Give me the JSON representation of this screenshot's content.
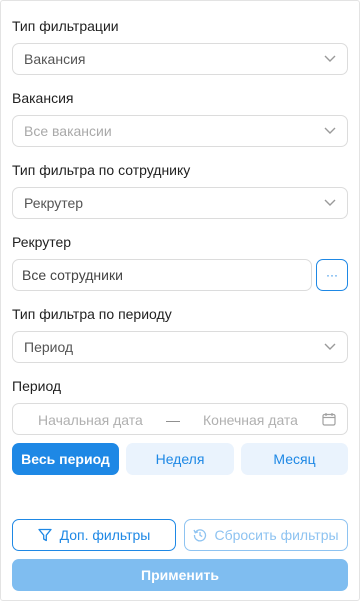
{
  "filter_type": {
    "label": "Тип фильтрации",
    "value": "Вакансия"
  },
  "vacancy": {
    "label": "Вакансия",
    "placeholder": "Все вакансии"
  },
  "employee_filter_type": {
    "label": "Тип фильтра по сотруднику",
    "value": "Рекрутер"
  },
  "recruiter": {
    "label": "Рекрутер",
    "value": "Все сотрудники",
    "more_label": "···"
  },
  "period_filter_type": {
    "label": "Тип фильтра по периоду",
    "value": "Период"
  },
  "period": {
    "label": "Период",
    "start_placeholder": "Начальная дата",
    "separator": "—",
    "end_placeholder": "Конечная дата",
    "presets": [
      "Весь период",
      "Неделя",
      "Месяц"
    ],
    "active_preset": "Весь период"
  },
  "actions": {
    "extra_filters": "Доп. фильтры",
    "reset_filters": "Сбросить фильтры",
    "apply": "Применить"
  },
  "colors": {
    "primary": "#1e88e5",
    "primary_disabled": "#7fbdf0",
    "preset_bg": "#eaf3fd",
    "border": "#dcdcdc"
  }
}
